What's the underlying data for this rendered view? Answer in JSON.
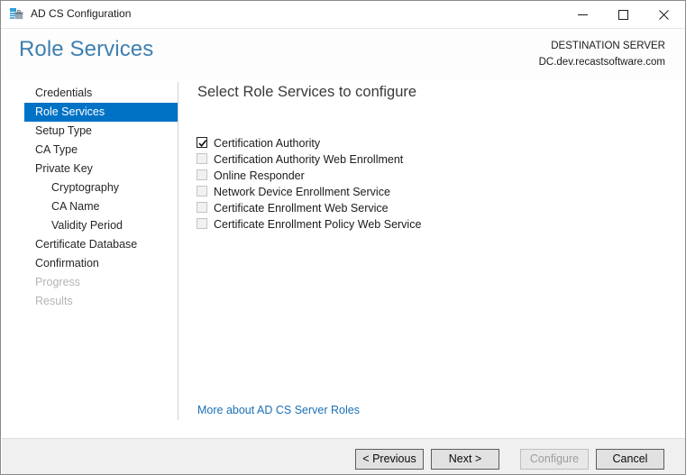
{
  "window": {
    "title": "AD CS Configuration",
    "icon": "toolbox-icon",
    "controls": {
      "minimize": "minimize-icon",
      "maximize": "maximize-icon",
      "close": "close-icon"
    }
  },
  "header": {
    "page_title": "Role Services",
    "destination_label": "DESTINATION SERVER",
    "destination_server": "DC.dev.recastsoftware.com",
    "title_color": "#3e7fb0"
  },
  "sidebar": {
    "selected_color": "#0072c6",
    "items": [
      {
        "label": "Credentials",
        "state": "normal",
        "indent": false
      },
      {
        "label": "Role Services",
        "state": "selected",
        "indent": false
      },
      {
        "label": "Setup Type",
        "state": "normal",
        "indent": false
      },
      {
        "label": "CA Type",
        "state": "normal",
        "indent": false
      },
      {
        "label": "Private Key",
        "state": "normal",
        "indent": false
      },
      {
        "label": "Cryptography",
        "state": "normal",
        "indent": true
      },
      {
        "label": "CA Name",
        "state": "normal",
        "indent": true
      },
      {
        "label": "Validity Period",
        "state": "normal",
        "indent": true
      },
      {
        "label": "Certificate Database",
        "state": "normal",
        "indent": false
      },
      {
        "label": "Confirmation",
        "state": "normal",
        "indent": false
      },
      {
        "label": "Progress",
        "state": "disabled",
        "indent": false
      },
      {
        "label": "Results",
        "state": "disabled",
        "indent": false
      }
    ]
  },
  "content": {
    "title": "Select Role Services to configure",
    "services": [
      {
        "label": "Certification Authority",
        "checked": true,
        "enabled": true
      },
      {
        "label": "Certification Authority Web Enrollment",
        "checked": false,
        "enabled": false
      },
      {
        "label": "Online Responder",
        "checked": false,
        "enabled": false
      },
      {
        "label": "Network Device Enrollment Service",
        "checked": false,
        "enabled": false
      },
      {
        "label": "Certificate Enrollment Web Service",
        "checked": false,
        "enabled": false
      },
      {
        "label": "Certificate Enrollment Policy Web Service",
        "checked": false,
        "enabled": false
      }
    ],
    "more_link": "More about AD CS Server Roles",
    "link_color": "#1a6fb5"
  },
  "footer": {
    "buttons": [
      {
        "label": "< Previous",
        "enabled": true
      },
      {
        "label": "Next >",
        "enabled": true
      },
      {
        "label": "Configure",
        "enabled": false
      },
      {
        "label": "Cancel",
        "enabled": true
      }
    ]
  }
}
